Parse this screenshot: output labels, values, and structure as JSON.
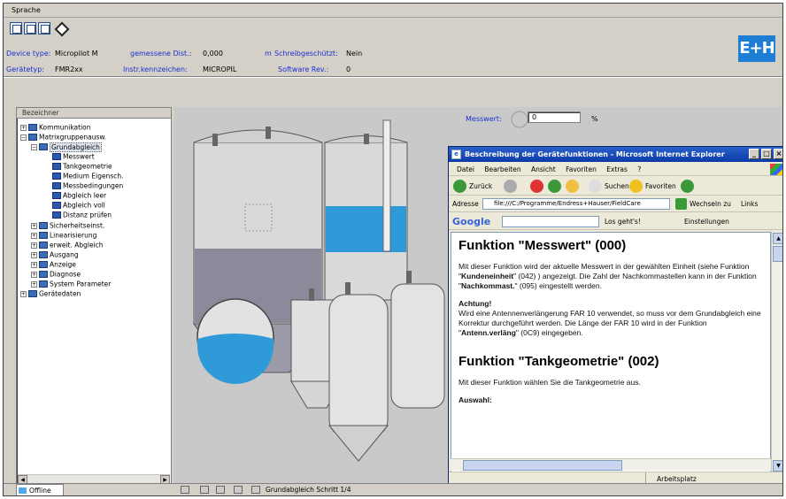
{
  "menu": {
    "label": "Sprache"
  },
  "toolbar": {
    "icons": [
      "table-view-icon",
      "grid-view-icon",
      "list-view-icon",
      "diamond-icon"
    ]
  },
  "device": {
    "device_type_label": "Device type:",
    "device_type_value": "Micropilot M",
    "measured_distance_label": "gemessene Dist.:",
    "measured_distance_value": "0,000",
    "measured_distance_unit": "m",
    "write_protect_label": "Schreibgeschützt:",
    "write_protect_value": "Nein",
    "device_kind_label": "Gerätetyp:",
    "device_kind_value": "FMR2xx",
    "instrument_id_label": "Instr.kennzeichen:",
    "instrument_id_value": "MICROPIL",
    "software_rev_label": "Software Rev.:",
    "software_rev_value": "0",
    "logo_text": "E+H"
  },
  "tree": {
    "header": "Bezeichner",
    "items": [
      {
        "label": "Kommunikation",
        "expander": "+"
      },
      {
        "label": "Matrixgruppenausw.",
        "expander": "−"
      },
      {
        "label": "Grundabgleich",
        "expander": "−"
      },
      {
        "label": "Messwert"
      },
      {
        "label": "Tankgeometrie"
      },
      {
        "label": "Medium Eigensch."
      },
      {
        "label": "Messbedingungen"
      },
      {
        "label": "Abgleich leer"
      },
      {
        "label": "Abgleich voll"
      },
      {
        "label": "Distanz prüfen"
      },
      {
        "label": "Sicherheitseinst.",
        "expander": "+"
      },
      {
        "label": "Linearisierung",
        "expander": "+"
      },
      {
        "label": "erweit. Abgleich",
        "expander": "+"
      },
      {
        "label": "Ausgang",
        "expander": "+"
      },
      {
        "label": "Anzeige",
        "expander": "+"
      },
      {
        "label": "Diagnose",
        "expander": "+"
      },
      {
        "label": "System Parameter",
        "expander": "+"
      },
      {
        "label": "Gerätedaten",
        "expander": "+"
      }
    ]
  },
  "measurement": {
    "label": "Messwert:",
    "value": "0",
    "unit": "%"
  },
  "ie_window": {
    "title": "Beschreibung der Gerätefunktionen - Microsoft Internet Explorer",
    "menu": [
      "Datei",
      "Bearbeiten",
      "Ansicht",
      "Favoriten",
      "Extras",
      "?"
    ],
    "nav": {
      "back": "Zurück",
      "search": "Suchen",
      "favorites": "Favoriten"
    },
    "address_label": "Adresse",
    "address_value": "file:///C:/Programme/Endress+Hauser/FieldCare",
    "go_label": "Wechseln zu",
    "links_label": "Links",
    "google_label": "Google",
    "google_go": "Los geht's!",
    "settings": "Einstellungen",
    "status_zone": "Arbeitsplatz"
  },
  "help": {
    "h1": "Funktion \"Messwert\" (000)",
    "p1_a": "Mit dieser Funktion wird der aktuelle Messwert in der gewählten Einheit (siehe Funktion \"",
    "p1_b": "Kundeneinheit",
    "p1_c": "\" (042) ) angezeigt. Die Zahl der Nachkommastellen kann in der Funktion \"",
    "p1_d": "Nachkommast.",
    "p1_e": "\" (095) eingestellt werden.",
    "note_title": "Achtung!",
    "p2_a": "Wird eine Antennenverlängerung FAR 10 verwendet, so muss vor dem Grundabgleich eine Korrektur durchgeführt werden. Die Länge der FAR 10 wird in der Funktion \"",
    "p2_b": "Antenn.verläng",
    "p2_c": "\" (0C9) eingegeben.",
    "h2": "Funktion \"Tankgeometrie\" (002)",
    "p3": "Mit dieser Funktion wählen Sie die Tankgeometrie aus.",
    "p4": "Auswahl:"
  },
  "statusbar": {
    "offline_label": "Offline",
    "step_text": "Grundabgleich Schritt 1/4"
  },
  "colors": {
    "link_blue": "#1a2fd4",
    "water_blue": "#2f9ad8",
    "tank_gray": "#c9c9c9",
    "sediment": "#8a8a9a",
    "logo_blue": "#1e7ed6"
  }
}
